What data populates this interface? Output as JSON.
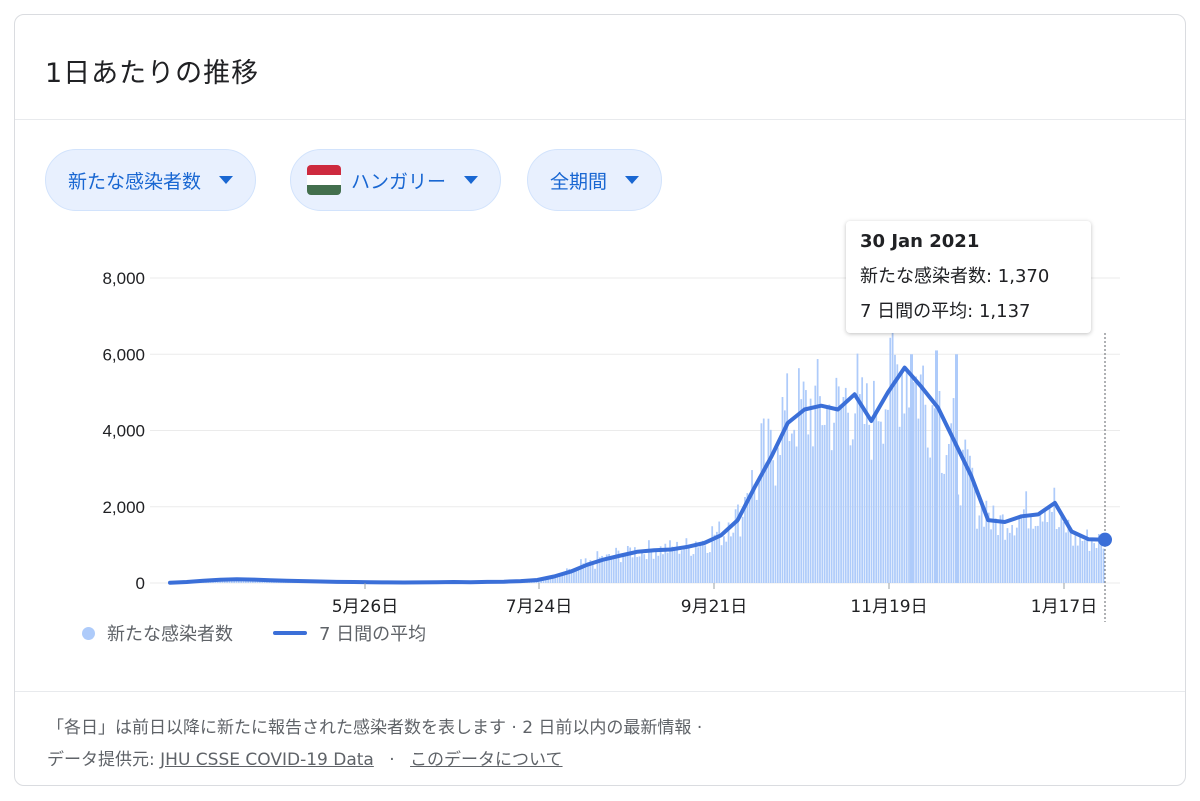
{
  "card": {
    "title": "1日あたりの推移",
    "chips": [
      {
        "label": "新たな感染者数"
      },
      {
        "label": "ハンガリー"
      },
      {
        "label": "全期間"
      }
    ],
    "footer_line1": "「各日」は前日以降に新たに報告された感染者数を表します · 2 日前以内の最新情報 ·",
    "footer_source_prefix": "データ提供元:",
    "footer_source_link": "JHU CSSE COVID-19 Data",
    "footer_dot": "·",
    "footer_about_link": "このデータについて"
  },
  "tooltip": {
    "date": "30 Jan 2021",
    "cases": "新たな感染者数: 1,370",
    "avg": "7 日間の平均: 1,137"
  },
  "legend": {
    "bars": "新たな感染者数",
    "line": "7 日間の平均"
  },
  "colors": {
    "bar": "#aecbfa",
    "line": "#3b6fd8",
    "accent": "#1967d2",
    "flag_red": "#cd2a3e",
    "flag_white": "#ffffff",
    "flag_green": "#436f4d"
  },
  "chart_data": {
    "type": "bar",
    "ylim": [
      0,
      8000
    ],
    "yticks": [
      "0",
      "2,000",
      "4,000",
      "6,000",
      "8,000"
    ],
    "xticks": [
      "5月26日",
      "7月24日",
      "9月21日",
      "11月19日",
      "1月17日"
    ],
    "series": [
      {
        "name": "新たな感染者数",
        "type": "bar",
        "x_start": "2020-03-04",
        "x_end": "2021-01-30",
        "weekly_values": [
          5,
          25,
          60,
          90,
          110,
          90,
          70,
          60,
          50,
          40,
          30,
          25,
          20,
          15,
          12,
          15,
          20,
          25,
          20,
          30,
          35,
          50,
          80,
          170,
          300,
          500,
          650,
          750,
          850,
          880,
          900,
          950,
          1100,
          1300,
          1700,
          2600,
          3400,
          4300,
          4500,
          4600,
          4500,
          4800,
          4300,
          5000,
          5600,
          5200,
          4700,
          3800,
          2900,
          2000,
          1600,
          1700,
          1900,
          2100,
          1450,
          1150,
          1100
        ],
        "peak_annotations": [
          6000,
          6100
        ]
      },
      {
        "name": "7 日間の平均",
        "type": "line",
        "weekly_values": [
          5,
          25,
          60,
          85,
          100,
          90,
          70,
          60,
          50,
          40,
          30,
          25,
          20,
          15,
          12,
          15,
          20,
          25,
          20,
          30,
          35,
          50,
          80,
          170,
          300,
          480,
          620,
          720,
          820,
          860,
          880,
          950,
          1050,
          1250,
          1650,
          2500,
          3300,
          4200,
          4550,
          4650,
          4550,
          4950,
          4250,
          5000,
          5650,
          5150,
          4600,
          3700,
          2800,
          1650,
          1600,
          1750,
          1800,
          2100,
          1350,
          1150,
          1137
        ]
      }
    ],
    "highlight": {
      "date": "30 Jan 2021",
      "cases": 1370,
      "avg": 1137
    },
    "legend_position": "bottom-left",
    "grid": true
  }
}
